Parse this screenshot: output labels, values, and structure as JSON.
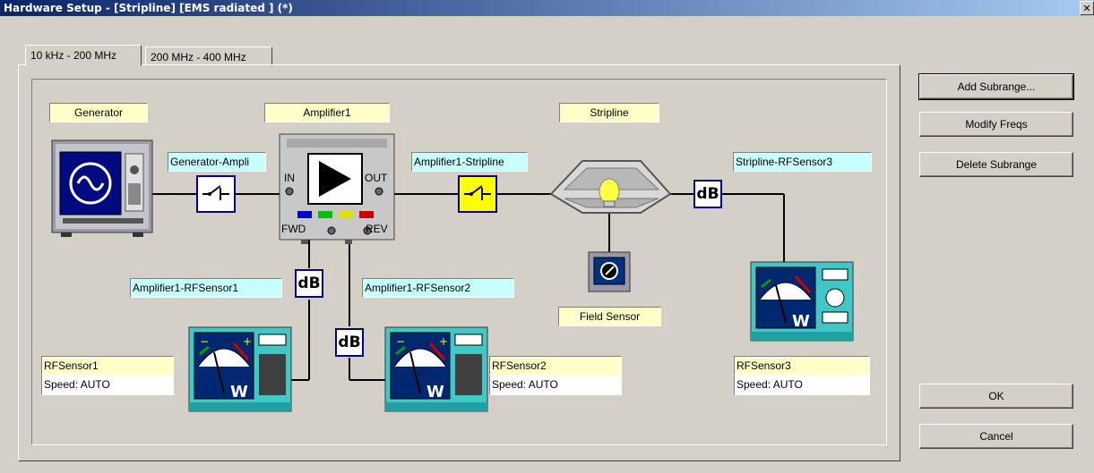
{
  "window": {
    "title": "Hardware Setup  -  [Stripline] [EMS radiated ] (*)",
    "close_glyph": "✕"
  },
  "tabs": [
    {
      "label": "10 kHz - 200 MHz",
      "active": true
    },
    {
      "label": "200 MHz - 400 MHz",
      "active": false
    }
  ],
  "devices": {
    "generator": "Generator",
    "amplifier": "Amplifier1",
    "stripline": "Stripline",
    "field_sensor": "Field Sensor"
  },
  "connections": {
    "gen_amp": "Generator-Ampli",
    "amp_strip": "Amplifier1-Stripline",
    "strip_rf3": "Stripline-RFSensor3",
    "amp_rf1": "Amplifier1-RFSensor1",
    "amp_rf2": "Amplifier1-RFSensor2"
  },
  "amplifier_ports": {
    "in": "IN",
    "out": "OUT",
    "fwd": "FWD",
    "rev": "REV"
  },
  "attenuator_label": "dB",
  "sensors": [
    {
      "name": "RFSensor1",
      "speed": "Speed: AUTO"
    },
    {
      "name": "RFSensor2",
      "speed": "Speed: AUTO"
    },
    {
      "name": "RFSensor3",
      "speed": "Speed: AUTO"
    }
  ],
  "buttons": {
    "add_subrange": "Add Subrange...",
    "modify_freqs": "Modify Freqs",
    "delete_subrange": "Delete Subrange",
    "ok": "OK",
    "cancel": "Cancel"
  },
  "icons": {
    "generator": "signal-generator-icon",
    "amplifier": "amplifier-icon",
    "switch": "switch-icon",
    "stripline": "stripline-antenna-icon",
    "field_sensor": "field-probe-icon",
    "power_meter": "power-meter-icon"
  }
}
